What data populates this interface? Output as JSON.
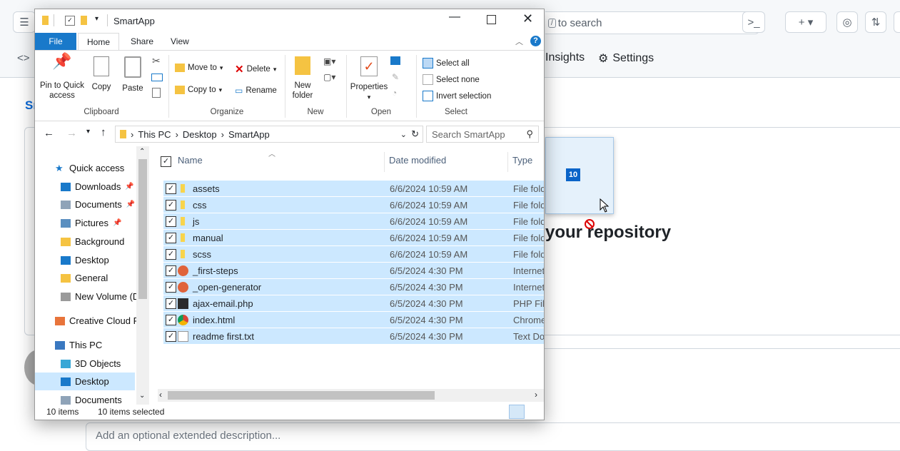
{
  "background_page": {
    "search_text": "to search",
    "tabs": {
      "insights": "Insights",
      "settings": "Settings"
    },
    "heading_partial": "your repository",
    "description_placeholder": "Add an optional extended description...",
    "left_partial": "Sr"
  },
  "drag": {
    "count_badge": "10"
  },
  "explorer": {
    "title": "SmartApp",
    "ribbon_tabs": [
      "File",
      "Home",
      "Share",
      "View"
    ],
    "ribbon": {
      "clipboard": {
        "pin": "Pin to Quick access",
        "copy": "Copy",
        "paste": "Paste",
        "label": "Clipboard"
      },
      "organize": {
        "move_to": "Move to",
        "copy_to": "Copy to",
        "delete": "Delete",
        "rename": "Rename",
        "label": "Organize"
      },
      "new": {
        "new_folder": "New folder",
        "label": "New"
      },
      "open": {
        "properties": "Properties",
        "label": "Open"
      },
      "select": {
        "select_all": "Select all",
        "select_none": "Select none",
        "invert": "Invert selection",
        "label": "Select"
      }
    },
    "breadcrumb": [
      "This PC",
      "Desktop",
      "SmartApp"
    ],
    "search_placeholder": "Search SmartApp",
    "nav_items": [
      {
        "label": "Quick access",
        "icon": "star-icon"
      },
      {
        "label": "Downloads",
        "icon": "download-icon"
      },
      {
        "label": "Documents",
        "icon": "documents-icon"
      },
      {
        "label": "Pictures",
        "icon": "pictures-icon"
      },
      {
        "label": "Background",
        "icon": "folder-icon"
      },
      {
        "label": "Desktop",
        "icon": "desktop-icon"
      },
      {
        "label": "General",
        "icon": "folder-icon"
      },
      {
        "label": "New Volume (D",
        "icon": "drive-icon"
      },
      {
        "label": "Creative Cloud Fi",
        "icon": "creative-cloud-icon"
      },
      {
        "label": "This PC",
        "icon": "pc-icon"
      },
      {
        "label": "3D Objects",
        "icon": "3d-objects-icon"
      },
      {
        "label": "Desktop",
        "icon": "desktop-icon"
      },
      {
        "label": "Documents",
        "icon": "documents-icon"
      }
    ],
    "columns": {
      "name": "Name",
      "date": "Date modified",
      "type": "Type"
    },
    "files": [
      {
        "name": "assets",
        "date": "6/6/2024 10:59 AM",
        "type": "File fold",
        "icon": "folder-icon"
      },
      {
        "name": "css",
        "date": "6/6/2024 10:59 AM",
        "type": "File fold",
        "icon": "folder-icon"
      },
      {
        "name": "js",
        "date": "6/6/2024 10:59 AM",
        "type": "File fold",
        "icon": "folder-icon"
      },
      {
        "name": "manual",
        "date": "6/6/2024 10:59 AM",
        "type": "File fold",
        "icon": "folder-icon"
      },
      {
        "name": "scss",
        "date": "6/6/2024 10:59 AM",
        "type": "File fold",
        "icon": "folder-icon"
      },
      {
        "name": "_first-steps",
        "date": "6/5/2024 4:30 PM",
        "type": "Internet",
        "icon": "internet-shortcut-icon"
      },
      {
        "name": "_open-generator",
        "date": "6/5/2024 4:30 PM",
        "type": "Internet",
        "icon": "internet-shortcut-icon"
      },
      {
        "name": "ajax-email.php",
        "date": "6/5/2024 4:30 PM",
        "type": "PHP File",
        "icon": "php-file-icon"
      },
      {
        "name": "index.html",
        "date": "6/5/2024 4:30 PM",
        "type": "Chrome",
        "icon": "chrome-icon"
      },
      {
        "name": "readme first.txt",
        "date": "6/5/2024 4:30 PM",
        "type": "Text Doc",
        "icon": "text-file-icon"
      }
    ],
    "status": {
      "items": "10 items",
      "selected": "10 items selected"
    }
  }
}
